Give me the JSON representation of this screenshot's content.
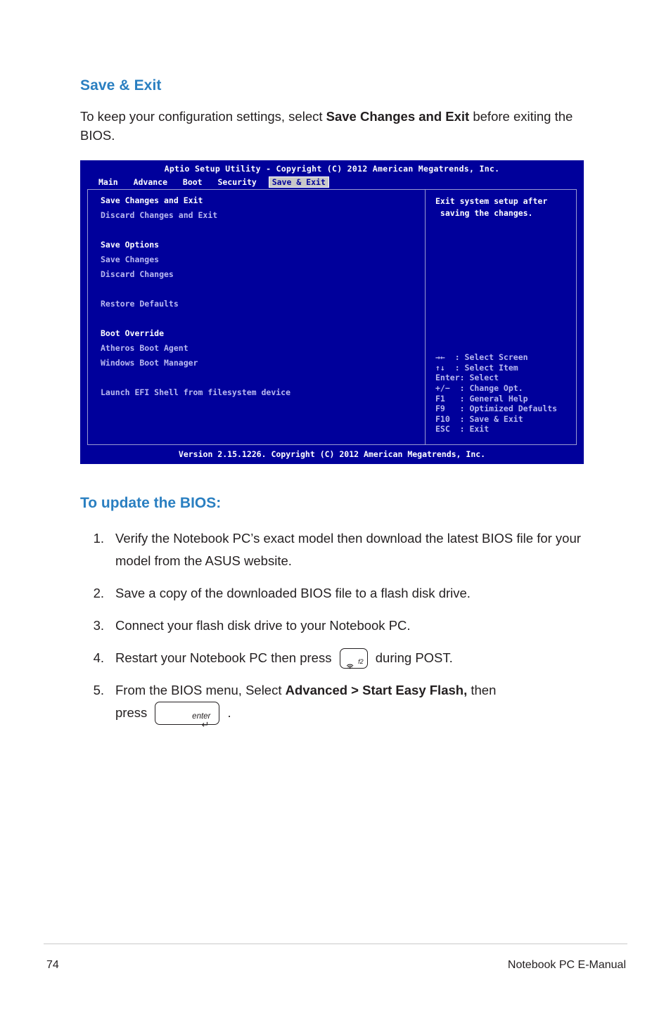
{
  "section1": {
    "title": "Save & Exit",
    "paragraph_part1": "To keep your configuration settings, select ",
    "paragraph_bold": "Save Changes and Exit",
    "paragraph_part2": " before exiting the BIOS."
  },
  "bios": {
    "title": "Aptio Setup Utility - Copyright (C) 2012 American Megatrends, Inc.",
    "menu": [
      {
        "label": "Main",
        "active": false
      },
      {
        "label": "Advance",
        "active": false
      },
      {
        "label": "Boot",
        "active": false
      },
      {
        "label": "Security",
        "active": false
      },
      {
        "label": "Save & Exit",
        "active": true
      }
    ],
    "left_items": [
      {
        "text": "Save Changes and Exit",
        "style": "sel"
      },
      {
        "text": "Discard Changes and Exit",
        "style": "normal"
      },
      {
        "text": "",
        "style": "spacer"
      },
      {
        "text": "Save Options",
        "style": "head"
      },
      {
        "text": "Save Changes",
        "style": "normal"
      },
      {
        "text": "Discard Changes",
        "style": "normal"
      },
      {
        "text": "",
        "style": "spacer"
      },
      {
        "text": "Restore Defaults",
        "style": "normal"
      },
      {
        "text": "",
        "style": "spacer"
      },
      {
        "text": "Boot Override",
        "style": "head"
      },
      {
        "text": "Atheros Boot Agent",
        "style": "normal"
      },
      {
        "text": "Windows Boot Manager",
        "style": "normal"
      },
      {
        "text": "",
        "style": "spacer"
      },
      {
        "text": "Launch EFI Shell from filesystem device",
        "style": "normal"
      }
    ],
    "help": "Exit system setup after\n saving the changes.",
    "keys": "→←  : Select Screen\n↑↓  : Select Item\nEnter: Select\n+/−  : Change Opt.\nF1   : General Help\nF9   : Optimized Defaults\nF10  : Save & Exit\nESC  : Exit",
    "footer": "Version 2.15.1226. Copyright (C) 2012 American Megatrends, Inc."
  },
  "section2": {
    "title": "To update the BIOS:",
    "steps": [
      {
        "num": "1.",
        "parts": [
          {
            "type": "text",
            "value": "Verify the Notebook PC’s exact model then download the latest BIOS file for your model from the ASUS website."
          }
        ]
      },
      {
        "num": "2.",
        "parts": [
          {
            "type": "text",
            "value": "Save a copy of the downloaded BIOS file to a flash disk drive."
          }
        ]
      },
      {
        "num": "3.",
        "parts": [
          {
            "type": "text",
            "value": "Connect your flash disk drive to your Notebook PC."
          }
        ]
      },
      {
        "num": "4.",
        "parts": [
          {
            "type": "text",
            "value": "Restart your Notebook PC then press "
          },
          {
            "type": "key",
            "value": "f2"
          },
          {
            "type": "text",
            "value": " during POST."
          }
        ]
      },
      {
        "num": "5.",
        "parts": [
          {
            "type": "text",
            "value": "From the BIOS menu, Select "
          },
          {
            "type": "bold",
            "value": "Advanced > Start Easy Flash,"
          },
          {
            "type": "text",
            "value": " then press "
          },
          {
            "type": "key",
            "value": "enter"
          },
          {
            "type": "text",
            "value": "."
          }
        ]
      }
    ],
    "step4_text_before": "Restart your Notebook PC then press",
    "step4_text_after": "during POST.",
    "step5_text_before": "From the BIOS menu, Select",
    "step5_bold": "Advanced > Start Easy Flash,",
    "step5_text_mid": "then",
    "step5_press": "press",
    "step5_period": ".",
    "key_f2_label": "f2",
    "key_enter_label": "enter",
    "key_enter_arrow": "↵"
  },
  "footer": {
    "page_number": "74",
    "doc_title": "Notebook PC E-Manual"
  }
}
